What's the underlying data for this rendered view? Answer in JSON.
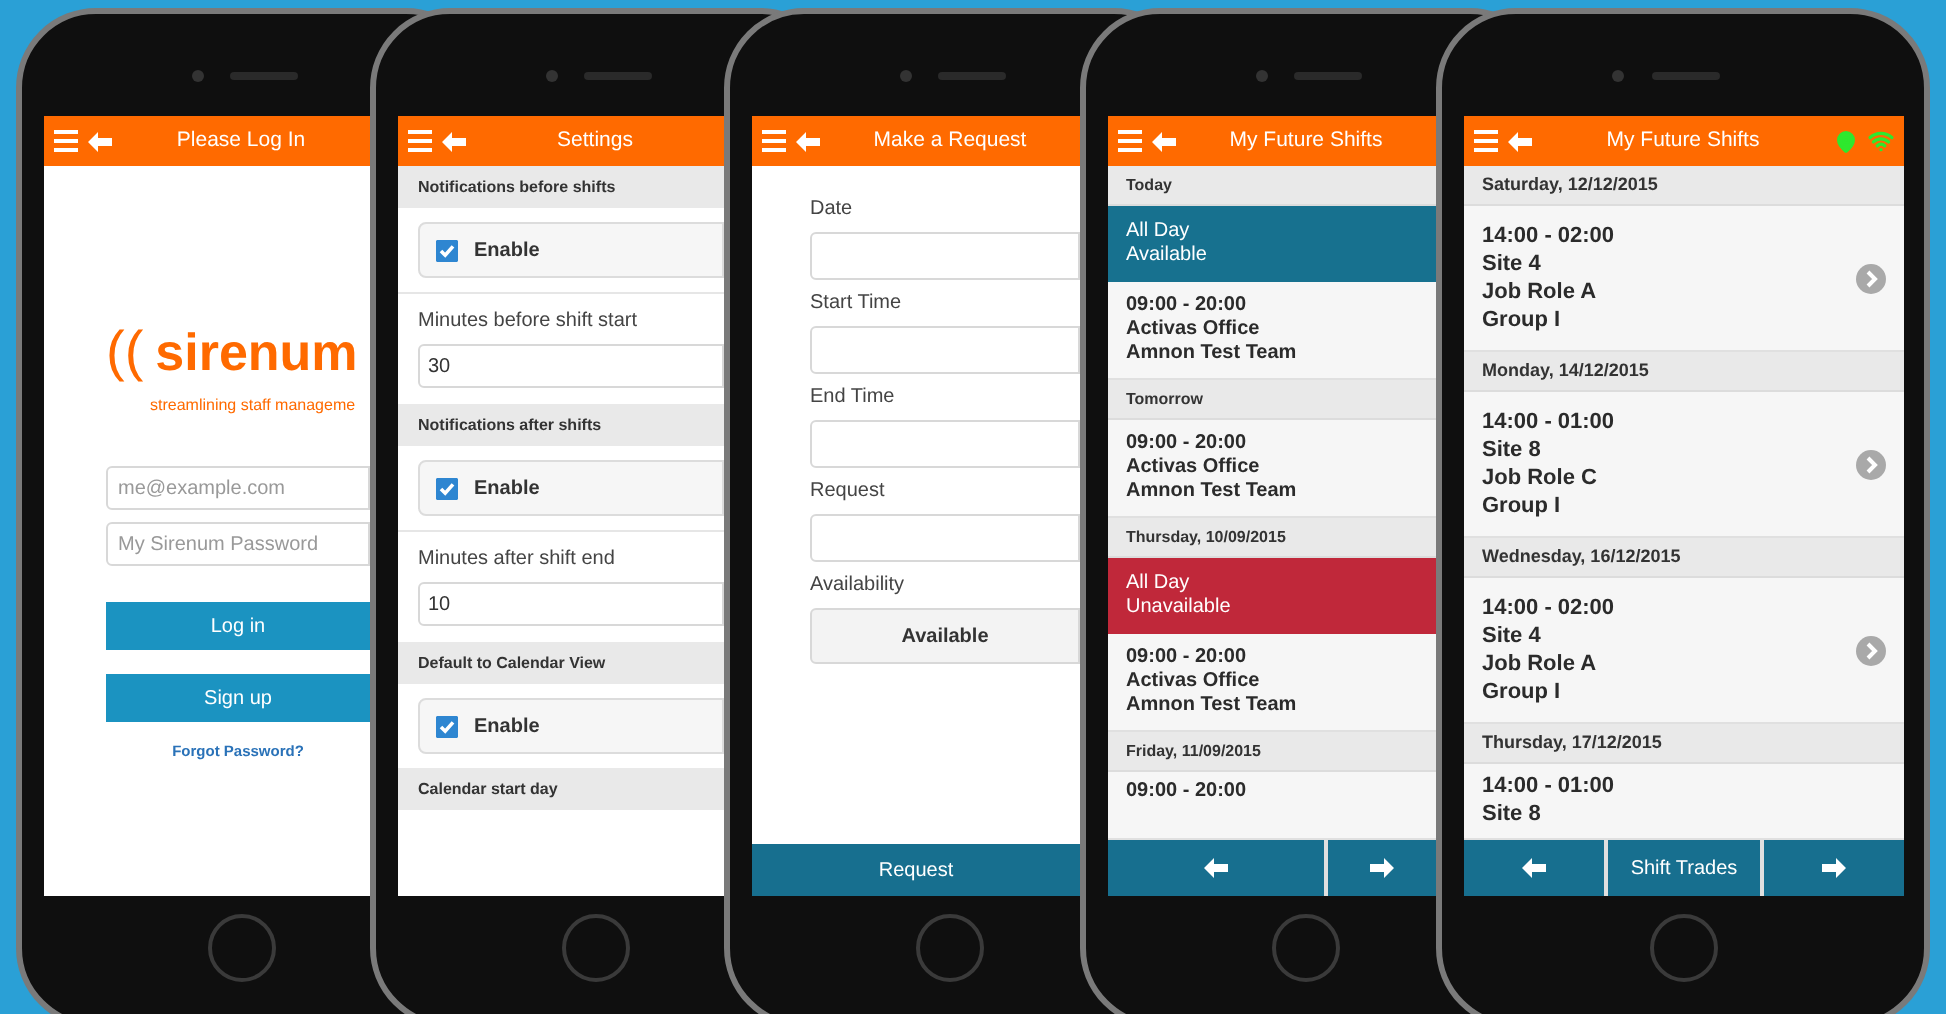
{
  "phones": [
    {
      "kind": "login",
      "title": "Please Log In",
      "logo": {
        "mark": "((",
        "name": "sirenum",
        "tagline": "streamlining staff manageme"
      },
      "inputs": [
        {
          "placeholder": "me@example.com"
        },
        {
          "placeholder": "My Sirenum Password"
        }
      ],
      "buttons": [
        "Log in",
        "Sign up"
      ],
      "link": "Forgot Password?"
    },
    {
      "kind": "settings",
      "title": "Settings",
      "sections": [
        {
          "heading": "Notifications before shifts",
          "checkbox": {
            "label": "Enable",
            "checked": true
          },
          "field": {
            "label": "Minutes before shift start",
            "value": "30"
          }
        },
        {
          "heading": "Notifications after shifts",
          "checkbox": {
            "label": "Enable",
            "checked": true
          },
          "field": {
            "label": "Minutes after shift end",
            "value": "10"
          }
        },
        {
          "heading": "Default to Calendar View",
          "checkbox": {
            "label": "Enable",
            "checked": true
          }
        },
        {
          "heading": "Calendar start day"
        }
      ]
    },
    {
      "kind": "request",
      "title": "Make a Request",
      "fields": [
        {
          "label": "Date"
        },
        {
          "label": "Start Time"
        },
        {
          "label": "End Time"
        },
        {
          "label": "Request"
        }
      ],
      "availability": {
        "label": "Availability",
        "value": "Available"
      },
      "submit": "Request"
    },
    {
      "kind": "shifts",
      "title": "My Future Shifts",
      "status_icons": false,
      "groups": [
        {
          "heading": "Today",
          "items": [
            {
              "kind": "availability",
              "color": "#17718f",
              "lines": [
                "All Day",
                "Available"
              ]
            },
            {
              "kind": "shift",
              "chevron": false,
              "lines": [
                "09:00 - 20:00",
                "Activas Office",
                "Amnon Test Team"
              ]
            }
          ]
        },
        {
          "heading": "Tomorrow",
          "items": [
            {
              "kind": "shift",
              "chevron": false,
              "lines": [
                "09:00 - 20:00",
                "Activas Office",
                "Amnon Test Team"
              ]
            }
          ]
        },
        {
          "heading": "Thursday, 10/09/2015",
          "items": [
            {
              "kind": "availability",
              "color": "#c0283a",
              "lines": [
                "All Day",
                "Unavailable"
              ]
            },
            {
              "kind": "shift",
              "chevron": false,
              "lines": [
                "09:00 - 20:00",
                "Activas Office",
                "Amnon Test Team"
              ]
            }
          ]
        },
        {
          "heading": "Friday, 11/09/2015",
          "items": [
            {
              "kind": "shift",
              "chevron": false,
              "lines": [
                "09:00 - 20:00"
              ]
            }
          ]
        }
      ]
    },
    {
      "kind": "shifts",
      "title": "My Future Shifts",
      "status_icons": true,
      "groups": [
        {
          "heading": "Saturday, 12/12/2015",
          "items": [
            {
              "kind": "shift",
              "chevron": true,
              "lines": [
                "14:00 - 02:00",
                "Site 4",
                "Job Role A",
                "Group I"
              ]
            }
          ]
        },
        {
          "heading": "Monday, 14/12/2015",
          "items": [
            {
              "kind": "shift",
              "chevron": true,
              "lines": [
                "14:00 - 01:00",
                "Site 8",
                "Job Role C",
                "Group I"
              ]
            }
          ]
        },
        {
          "heading": "Wednesday, 16/12/2015",
          "items": [
            {
              "kind": "shift",
              "chevron": true,
              "lines": [
                "14:00 - 02:00",
                "Site 4",
                "Job Role A",
                "Group I"
              ]
            }
          ]
        },
        {
          "heading": "Thursday, 17/12/2015",
          "items": [
            {
              "kind": "shift",
              "chevron": false,
              "lines": [
                "14:00 - 01:00",
                "Site 8"
              ]
            }
          ]
        }
      ],
      "footer": {
        "label": "Shift Trades"
      }
    }
  ]
}
